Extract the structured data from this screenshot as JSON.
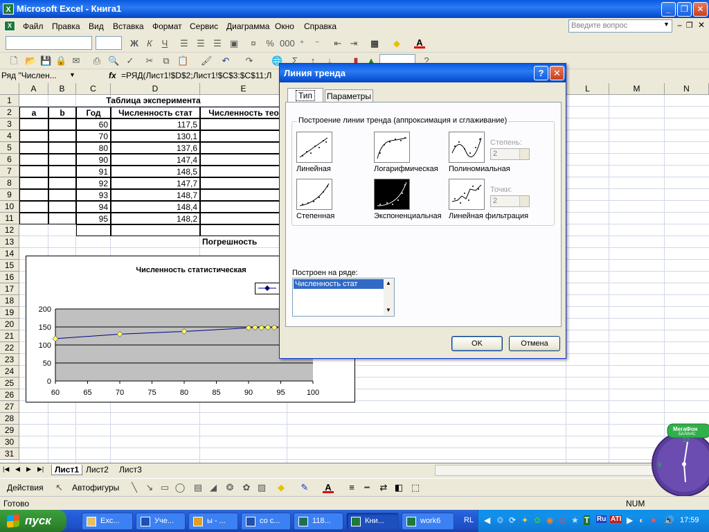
{
  "app": {
    "title": "Microsoft Excel - Книга1",
    "icon_text": "X"
  },
  "menu": [
    "Файл",
    "Правка",
    "Вид",
    "Вставка",
    "Формат",
    "Сервис",
    "Диаграмма",
    "Окно",
    "Справка"
  ],
  "help_placeholder": "Введите вопрос",
  "formula_bar": {
    "name_box": "Ряд \"Числен...",
    "fx": "fx",
    "formula": "=РЯД(Лист1!$D$2;Лист1!$C$3:$C$11;Л"
  },
  "columns": [
    "A",
    "B",
    "C",
    "D",
    "E",
    "L",
    "M",
    "N"
  ],
  "rows": [
    "1",
    "2",
    "3",
    "4",
    "5",
    "6",
    "7",
    "8",
    "9",
    "10",
    "11",
    "12",
    "13",
    "14",
    "15",
    "16",
    "17",
    "18",
    "19",
    "20",
    "21",
    "22",
    "23",
    "24",
    "25",
    "26",
    "27",
    "28",
    "29",
    "30",
    "31"
  ],
  "sheet": {
    "title": "Таблица эксперимента",
    "headers": [
      "a",
      "b",
      "Год",
      "Численность стат",
      "Численность тео"
    ],
    "years": [
      "60",
      "70",
      "80",
      "90",
      "91",
      "92",
      "93",
      "94",
      "95"
    ],
    "values": [
      "117,5",
      "130,1",
      "137,6",
      "147,4",
      "148,5",
      "147,7",
      "148,7",
      "148,4",
      "148,2"
    ],
    "error_label": "Погрешность"
  },
  "chart_data": {
    "type": "scatter",
    "title": "Численность статистическая",
    "x": [
      60,
      70,
      80,
      90,
      91,
      92,
      93,
      94,
      95
    ],
    "series": [
      {
        "values": [
          117.5,
          130.1,
          137.6,
          147.4,
          148.5,
          147.7,
          148.7,
          148.4,
          148.2
        ]
      }
    ],
    "xlim": [
      60,
      100
    ],
    "ylim": [
      0,
      200
    ],
    "x_ticks": [
      "60",
      "65",
      "70",
      "75",
      "80",
      "85",
      "90",
      "95",
      "100"
    ],
    "y_ticks": [
      "0",
      "50",
      "100",
      "150",
      "200"
    ],
    "grid": true,
    "plot_background": "#c0c0c0",
    "line_color": "#000080",
    "marker_color": "#ffff66",
    "legend_position": "right"
  },
  "sheet_tabs": [
    "Лист1",
    "Лист2",
    "Лист3"
  ],
  "draw_toolbar": {
    "actions": "Действия",
    "autoshapes": "Автофигуры"
  },
  "status": {
    "ready": "Готово",
    "num": "NUM"
  },
  "dialog": {
    "title": "Линия тренда",
    "tabs": [
      "Тип",
      "Параметры"
    ],
    "group_title": "Построение линии тренда (аппроксимация и сглаживание)",
    "types": [
      "Линейная",
      "Логарифмическая",
      "Полиномиальная",
      "Степенная",
      "Экспоненциальная",
      "Линейная фильтрация"
    ],
    "degree_label": "Степень:",
    "degree_value": "2",
    "points_label": "Точки:",
    "points_value": "2",
    "series_label": "Построен на ряде:",
    "series_item": "Численность стат",
    "ok": "OK",
    "cancel": "Отмена"
  },
  "taskbar": {
    "start": "пуск",
    "tasks": [
      "Exc...",
      "Уче...",
      "ы - ...",
      "со с...",
      "118...",
      "Кни...",
      "work6"
    ],
    "lang": "RL",
    "clock": "17:59"
  },
  "widget": {
    "brand": "МегаФон",
    "sub": "БАЛАНС"
  },
  "accent": "#0a5ae0"
}
